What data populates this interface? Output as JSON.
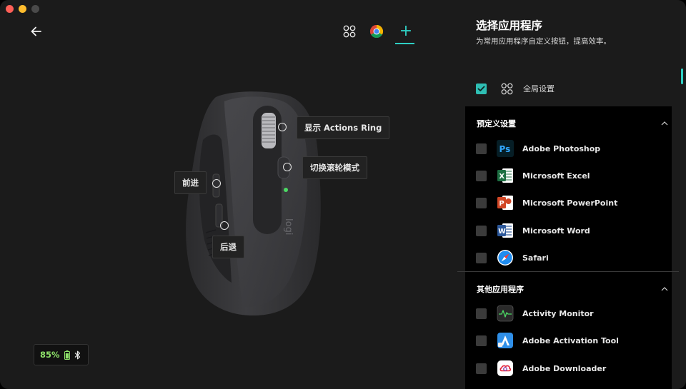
{
  "window": {
    "traffic_lights": [
      "close",
      "minimize",
      "zoom"
    ]
  },
  "toolbar": {
    "back_icon": "back-arrow-icon",
    "apps": [
      {
        "name": "all-apps",
        "icon": "four-circles-icon"
      },
      {
        "name": "chrome",
        "icon": "chrome-icon"
      },
      {
        "name": "add",
        "icon": "plus-icon",
        "selected": true
      }
    ],
    "add_symbol": "+"
  },
  "device": {
    "callouts": {
      "actions_ring": "显示 Actions Ring",
      "scroll_mode": "切换滚轮模式",
      "forward": "前进",
      "back": "后退"
    },
    "battery": {
      "percent": "85%",
      "connection_icon": "bluetooth-icon"
    }
  },
  "panel": {
    "title": "选择应用程序",
    "subtitle": "为常用应用程序自定义按钮，提高效率。",
    "global": {
      "label": "全局设置",
      "checked": true
    },
    "predefined": {
      "title": "预定义设置",
      "apps": [
        {
          "name": "Adobe Photoshop",
          "icon": "photoshop-icon",
          "checked": false
        },
        {
          "name": "Microsoft Excel",
          "icon": "excel-icon",
          "checked": false
        },
        {
          "name": "Microsoft PowerPoint",
          "icon": "powerpoint-icon",
          "checked": false
        },
        {
          "name": "Microsoft Word",
          "icon": "word-icon",
          "checked": false
        },
        {
          "name": "Safari",
          "icon": "safari-icon",
          "checked": false
        }
      ]
    },
    "others": {
      "title": "其他应用程序",
      "apps": [
        {
          "name": "Activity Monitor",
          "icon": "activity-monitor-icon",
          "checked": false
        },
        {
          "name": "Adobe Activation Tool",
          "icon": "adobe-activation-tool-icon",
          "checked": false
        },
        {
          "name": "Adobe Downloader",
          "icon": "adobe-downloader-icon",
          "checked": false
        }
      ]
    }
  },
  "colors": {
    "accent": "#2fd0c4",
    "battery_green": "#8fe36a",
    "background": "#1b1b1b",
    "list_background": "#000000"
  }
}
